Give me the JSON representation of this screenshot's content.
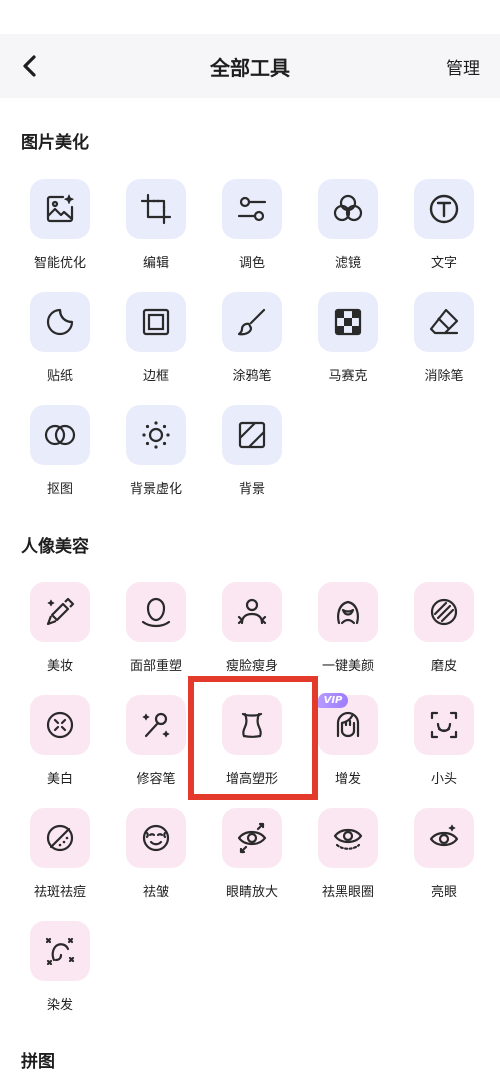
{
  "header": {
    "title": "全部工具",
    "manage_label": "管理"
  },
  "sections": {
    "beautify": {
      "title": "图片美化",
      "items": [
        "智能优化",
        "编辑",
        "调色",
        "滤镜",
        "文字",
        "贴纸",
        "边框",
        "涂鸦笔",
        "马赛克",
        "消除笔",
        "抠图",
        "背景虚化",
        "背景"
      ]
    },
    "portrait": {
      "title": "人像美容",
      "items": [
        "美妆",
        "面部重塑",
        "瘦脸瘦身",
        "一键美颜",
        "磨皮",
        "美白",
        "修容笔",
        "增高塑形",
        "增发",
        "小头",
        "祛斑祛痘",
        "祛皱",
        "眼睛放大",
        "祛黑眼圈",
        "亮眼",
        "染发"
      ],
      "vip_badge": "VIP"
    },
    "collage": {
      "title": "拼图"
    }
  },
  "colors": {
    "tile_blue": "#e8ecfb",
    "tile_pink": "#fbe7f1",
    "highlight": "#e33a2c",
    "icon": "#2a2a2a"
  },
  "icons": {
    "beautify": [
      "image-star-icon",
      "crop-icon",
      "sliders-icon",
      "filter-circles-icon",
      "text-circle-icon",
      "sticker-icon",
      "frame-icon",
      "brush-icon",
      "mosaic-icon",
      "eraser-icon",
      "cutout-icon",
      "blur-bg-icon",
      "background-icon"
    ],
    "portrait": [
      "makeup-icon",
      "face-reshape-icon",
      "body-slim-icon",
      "one-tap-beauty-icon",
      "smooth-skin-icon",
      "whiten-icon",
      "contour-brush-icon",
      "height-shape-icon",
      "hair-add-icon",
      "small-head-icon",
      "spot-remove-icon",
      "wrinkle-remove-icon",
      "eye-enlarge-icon",
      "dark-circle-icon",
      "bright-eye-icon",
      "hair-dye-icon"
    ]
  }
}
